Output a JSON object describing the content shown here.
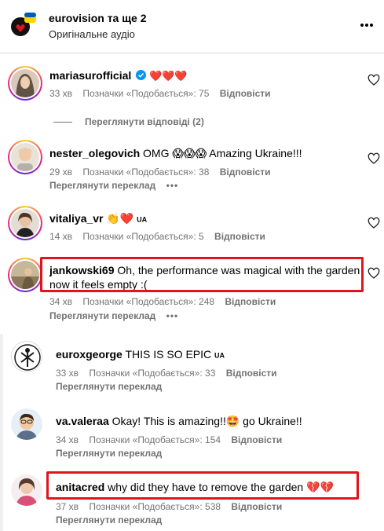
{
  "header": {
    "title_user": "eurovision",
    "title_rest": "та ще 2",
    "subtitle": "Оригінальне аудіо"
  },
  "comments": [
    {
      "username": "mariasurofficial",
      "verified": true,
      "text": "❤️❤️❤️",
      "time": "33 хв",
      "likes": "Позначки «Подобається»: 75",
      "reply": "Відповісти",
      "view_replies": "Переглянути відповіді (2)"
    },
    {
      "username": "nester_olegovich",
      "text": "OMG 😱😱😱 Amazing Ukraine!!!",
      "time": "29 хв",
      "likes": "Позначки «Подобається»: 38",
      "reply": "Відповісти",
      "translate": "Переглянути переклад"
    },
    {
      "username": "vitaliya_vr",
      "text": "👏❤️",
      "flag": "UA",
      "time": "14 хв",
      "likes": "Позначки «Подобається»: 5",
      "reply": "Відповісти"
    },
    {
      "username": "jankowski69",
      "text_line1": "Oh, the performance was magical with the garden",
      "text_line2": "now it feels empty :(",
      "time": "34 хв",
      "likes": "Позначки «Подобається»: 248",
      "reply": "Відповісти",
      "translate": "Переглянути переклад"
    },
    {
      "username": "euroxgeorge",
      "text": "THIS IS SO EPIC",
      "flag": "UA",
      "time": "33 хв",
      "likes": "Позначки «Подобається»: 33",
      "reply": "Відповісти",
      "translate": "Переглянути переклад"
    },
    {
      "username": "va.valeraa",
      "text": "Okay! This is amazing!!🤩 go Ukraine!!",
      "time": "34 хв",
      "likes": "Позначки «Подобається»: 154",
      "reply": "Відповісти",
      "translate": "Переглянути переклад"
    },
    {
      "username": "anitacred",
      "text": "why did they have to remove the garden 💔💔",
      "time": "37 хв",
      "likes": "Позначки «Подобається»: 538",
      "reply": "Відповісти",
      "translate": "Переглянути переклад"
    }
  ],
  "colors": {
    "highlight": "#e0141e",
    "muted": "#737373",
    "verified": "#0095f6"
  }
}
